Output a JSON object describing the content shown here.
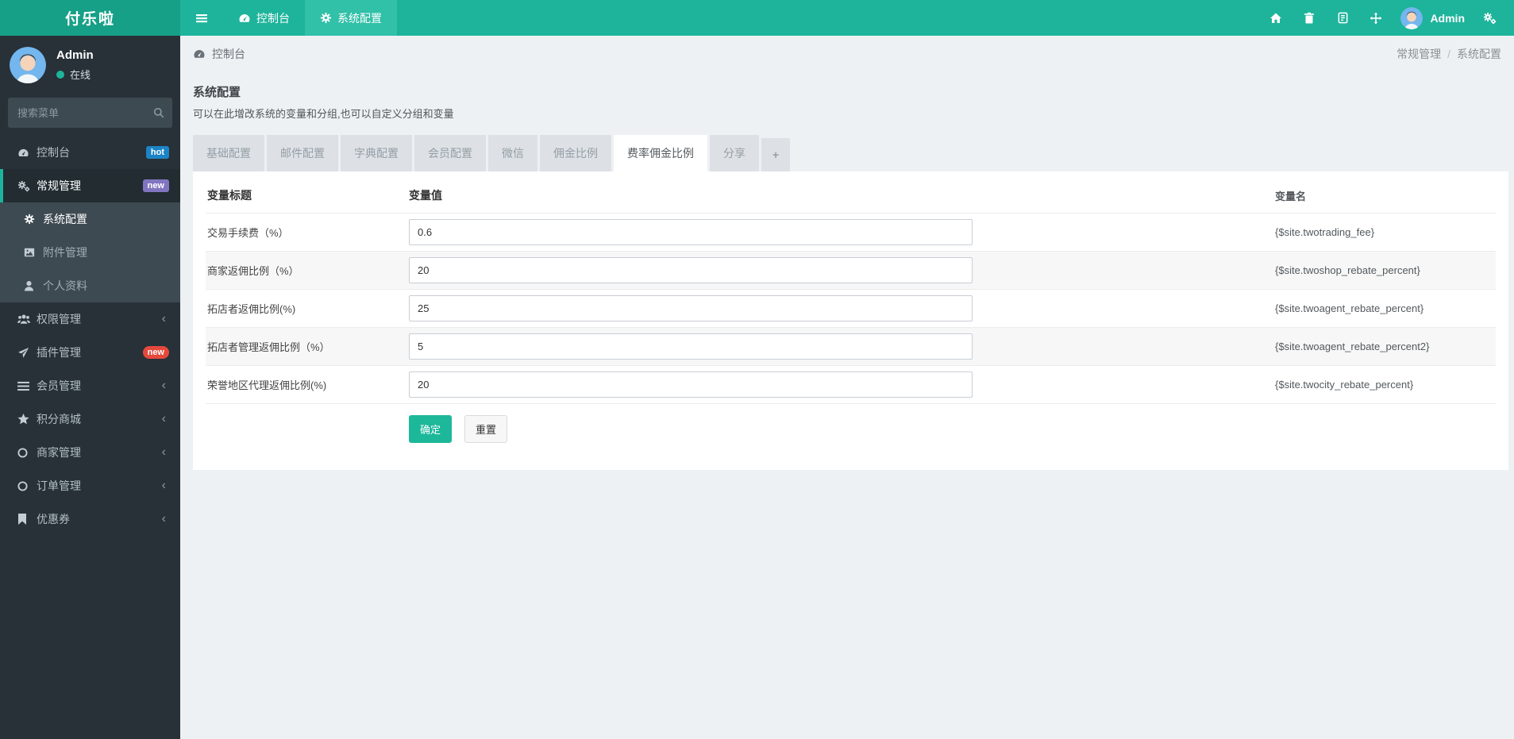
{
  "brand": "付乐啦",
  "navbar": {
    "items": [
      {
        "label": "控制台",
        "icon": "dashboard-icon",
        "active": false
      },
      {
        "label": "系统配置",
        "icon": "gear-icon",
        "active": true
      }
    ],
    "right": {
      "user_name": "Admin",
      "icons": [
        "home-icon",
        "trash-icon",
        "log-icon",
        "expand-icon",
        "gears-icon"
      ]
    }
  },
  "sidebar": {
    "profile": {
      "name": "Admin",
      "status": "在线"
    },
    "search": {
      "placeholder": "搜索菜单"
    },
    "menu": [
      {
        "label": "控制台",
        "icon": "dashboard-icon",
        "badge": "hot"
      },
      {
        "label": "常规管理",
        "icon": "cogs-icon",
        "badge": "new",
        "active": true
      },
      {
        "label": "系统配置",
        "icon": "gear-icon",
        "submenu_of": "常规管理",
        "active": true
      },
      {
        "label": "附件管理",
        "icon": "image-icon",
        "submenu_of": "常规管理"
      },
      {
        "label": "个人资料",
        "icon": "user-icon",
        "submenu_of": "常规管理"
      },
      {
        "label": "权限管理",
        "icon": "users-icon",
        "collapsible": true
      },
      {
        "label": "插件管理",
        "icon": "plane-icon",
        "badge": "new"
      },
      {
        "label": "会员管理",
        "icon": "list-icon",
        "collapsible": true
      },
      {
        "label": "积分商城",
        "icon": "star-icon",
        "collapsible": true
      },
      {
        "label": "商家管理",
        "icon": "circle-icon",
        "collapsible": true
      },
      {
        "label": "订单管理",
        "icon": "circle-icon",
        "collapsible": true
      },
      {
        "label": "优惠券",
        "icon": "bookmark-icon",
        "collapsible": true
      }
    ]
  },
  "breadcrumb": {
    "left": "控制台",
    "right_parent": "常规管理",
    "separator": "/",
    "right_current": "系统配置"
  },
  "panel": {
    "title": "系统配置",
    "subtitle": "可以在此增改系统的变量和分组,也可以自定义分组和变量",
    "tabs": [
      {
        "label": "基础配置",
        "active": false
      },
      {
        "label": "邮件配置",
        "active": false
      },
      {
        "label": "字典配置",
        "active": false
      },
      {
        "label": "会员配置",
        "active": false
      },
      {
        "label": "微信",
        "active": false
      },
      {
        "label": "佣金比例",
        "active": false
      },
      {
        "label": "费率佣金比例",
        "active": true
      },
      {
        "label": "分享",
        "active": false
      },
      {
        "label": "+",
        "active": false
      }
    ],
    "table": {
      "headers": [
        "变量标题",
        "变量值",
        "变量名"
      ],
      "rows": [
        {
          "title": "交易手续费（%）",
          "value": "0.6",
          "name": "{$site.twotrading_fee}"
        },
        {
          "title": "商家返佣比例（%）",
          "value": "20",
          "name": "{$site.twoshop_rebate_percent}"
        },
        {
          "title": "拓店者返佣比例(%)",
          "value": "25",
          "name": "{$site.twoagent_rebate_percent}"
        },
        {
          "title": "拓店者管理返佣比例（%）",
          "value": "5",
          "name": "{$site.twoagent_rebate_percent2}"
        },
        {
          "title": "荣誉地区代理返佣比例(%)",
          "value": "20",
          "name": "{$site.twocity_rebate_percent}"
        }
      ]
    },
    "buttons": {
      "confirm": "确定",
      "reset": "重置"
    }
  },
  "icons": {
    "chevron_collapsed": "‹"
  },
  "colors": {
    "navbar": "#1eb49b",
    "brand_bg": "#16a087",
    "navbar_active_tab": "#31c0a8",
    "sidebar_bg": "#283138",
    "submenu_bg": "#3e4a52",
    "active_stripe": "#1eb49b",
    "badge_hot": "#1c84c6",
    "badge_new_purple": "#8175c1",
    "badge_new_red": "#e4493c",
    "page_bg": "#eef1f4",
    "online_dot": "#1eb49b",
    "confirm_button": "#1db89a"
  }
}
